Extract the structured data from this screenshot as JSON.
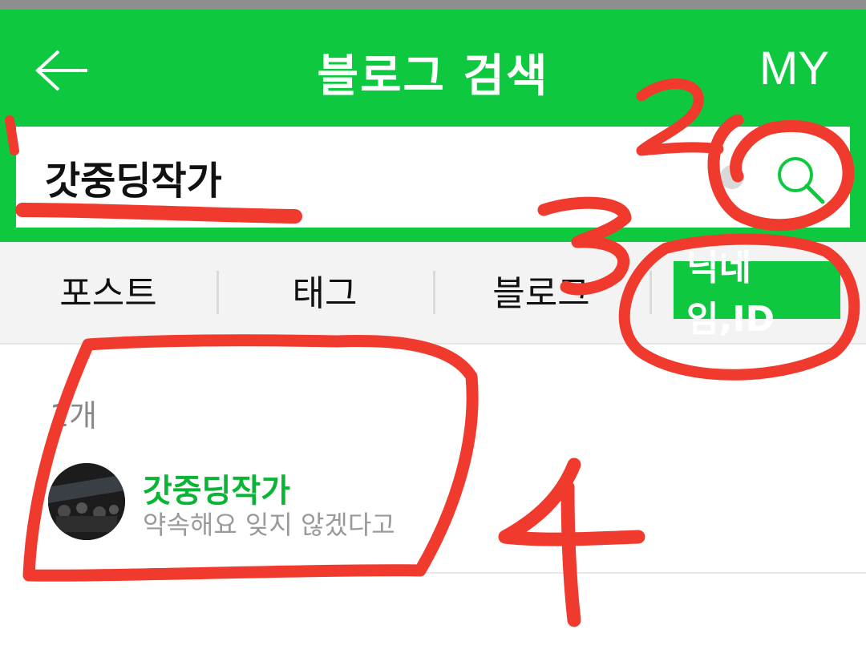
{
  "header": {
    "title": "블로그 검색",
    "my_label": "MY"
  },
  "search": {
    "value": "갓중딩작가"
  },
  "tabs": [
    {
      "label": "포스트"
    },
    {
      "label": "태그"
    },
    {
      "label": "블로그"
    },
    {
      "label": "닉네임,ID"
    }
  ],
  "results": {
    "count_label": "1개",
    "items": [
      {
        "name": "갓중딩작가",
        "description": "약속해요 잊지 않겠다고"
      }
    ]
  },
  "annotations": {
    "numbers": [
      "1",
      "2",
      "3",
      "4"
    ],
    "color": "#f03a2e"
  },
  "colors": {
    "accent": "#0ec93f",
    "result_name": "#0ab434"
  }
}
